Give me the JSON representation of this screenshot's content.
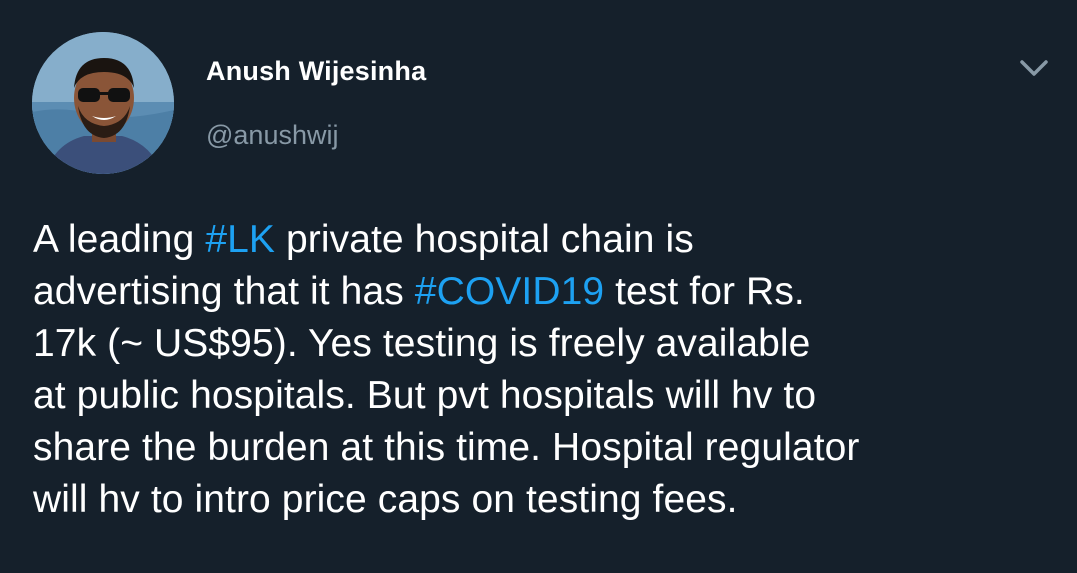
{
  "tweet": {
    "author": {
      "name": "Anush Wijesinha",
      "handle": "@anushwij"
    },
    "menu_icon": "chevron-down-icon",
    "lines": [
      {
        "before": "A leading ",
        "hashtag": "#LK",
        "after": " private hospital chain is"
      },
      {
        "before": "advertising that it has ",
        "hashtag": "#COVID19",
        "after": " test for Rs."
      },
      {
        "text": "17k (~ US$95). Yes testing is freely available"
      },
      {
        "text": "at public hospitals. But pvt  hospitals will hv to"
      },
      {
        "text": "share the burden at this time. Hospital regulator"
      },
      {
        "text": "will hv to intro price caps on testing fees."
      }
    ]
  },
  "colors": {
    "background": "#15202b",
    "text": "#ffffff",
    "secondary_text": "#8899a6",
    "hashtag": "#1da1f2"
  }
}
